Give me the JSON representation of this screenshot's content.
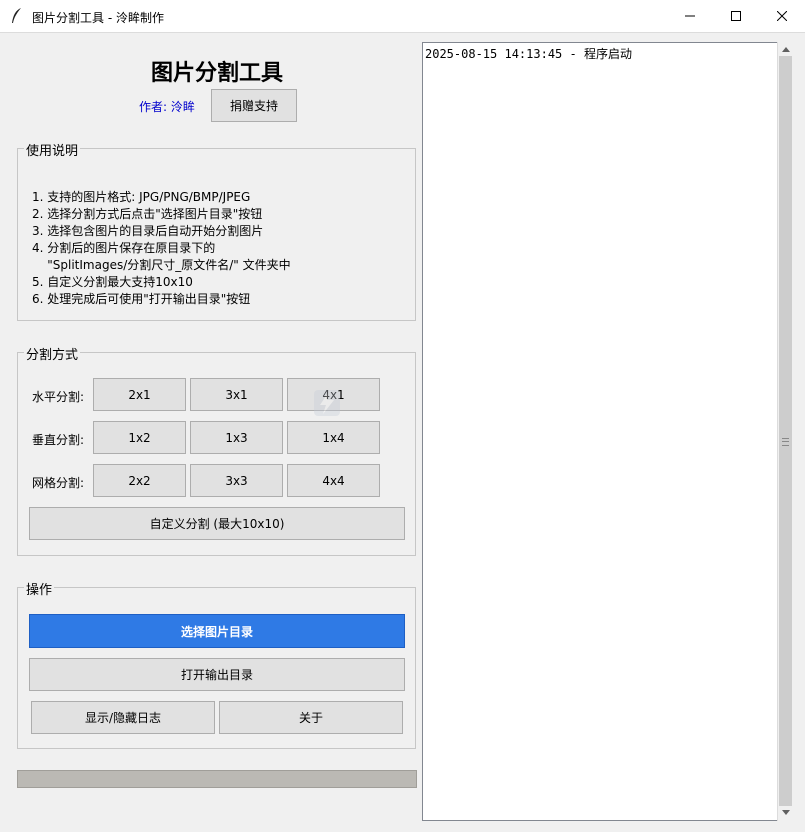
{
  "window": {
    "title": "图片分割工具 - 泠眸制作"
  },
  "header": {
    "app_title": "图片分割工具",
    "author": "作者: 泠眸",
    "donate_label": "捐赠支持"
  },
  "instructions": {
    "legend": "使用说明",
    "lines": [
      "1. 支持的图片格式: JPG/PNG/BMP/JPEG",
      "2. 选择分割方式后点击\"选择图片目录\"按钮",
      "3. 选择包含图片的目录后自动开始分割图片",
      "4. 分割后的图片保存在原目录下的",
      "    \"SplitImages/分割尺寸_原文件名/\" 文件夹中",
      "5. 自定义分割最大支持10x10",
      "6. 处理完成后可使用\"打开输出目录\"按钮"
    ]
  },
  "split_modes": {
    "legend": "分割方式",
    "horizontal": {
      "label": "水平分割:",
      "options": [
        "2x1",
        "3x1",
        "4x1"
      ]
    },
    "vertical": {
      "label": "垂直分割:",
      "options": [
        "1x2",
        "1x3",
        "1x4"
      ]
    },
    "grid": {
      "label": "网格分割:",
      "options": [
        "2x2",
        "3x3",
        "4x4"
      ]
    },
    "custom_label": "自定义分割 (最大10x10)"
  },
  "operations": {
    "legend": "操作",
    "select_dir": "选择图片目录",
    "open_output": "打开输出目录",
    "toggle_log": "显示/隐藏日志",
    "about": "关于"
  },
  "log": {
    "lines": [
      "2025-08-15 14:13:45 - 程序启动"
    ]
  },
  "progress": {
    "value": 0
  },
  "colors": {
    "primary": "#2f7ae5",
    "author": "#0000cc"
  }
}
